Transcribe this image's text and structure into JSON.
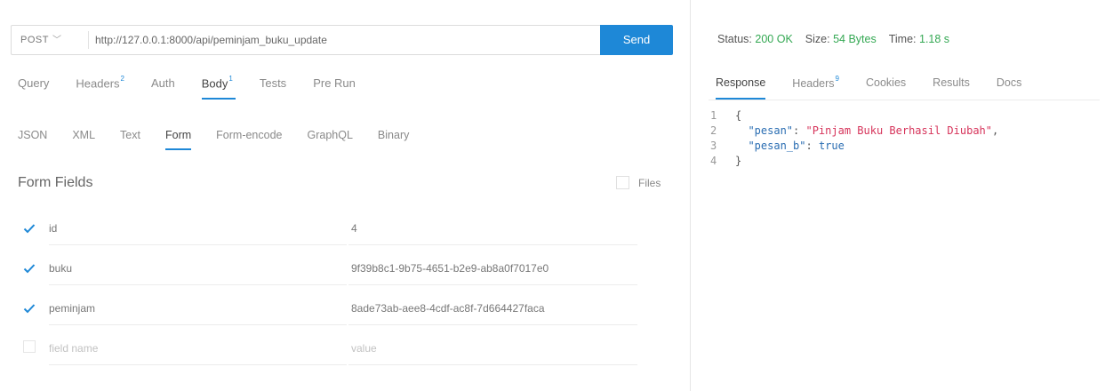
{
  "request": {
    "method": "POST",
    "url": "http://127.0.0.1:8000/api/peminjam_buku_update",
    "send_label": "Send"
  },
  "tabs": [
    {
      "label": "Query",
      "badge": ""
    },
    {
      "label": "Headers",
      "badge": "2"
    },
    {
      "label": "Auth",
      "badge": ""
    },
    {
      "label": "Body",
      "badge": "1"
    },
    {
      "label": "Tests",
      "badge": ""
    },
    {
      "label": "Pre Run",
      "badge": ""
    }
  ],
  "body_tabs": [
    "JSON",
    "XML",
    "Text",
    "Form",
    "Form-encode",
    "GraphQL",
    "Binary"
  ],
  "form": {
    "title": "Form Fields",
    "files_label": "Files",
    "rows": [
      {
        "name": "id",
        "value": "4",
        "checked": true
      },
      {
        "name": "buku",
        "value": "9f39b8c1-9b75-4651-b2e9-ab8a0f7017e0",
        "checked": true
      },
      {
        "name": "peminjam",
        "value": "8ade73ab-aee8-4cdf-ac8f-7d664427faca",
        "checked": true
      }
    ],
    "name_placeholder": "field name",
    "value_placeholder": "value"
  },
  "response": {
    "status_label": "Status:",
    "status_value": "200 OK",
    "size_label": "Size:",
    "size_value": "54 Bytes",
    "time_label": "Time:",
    "time_value": "1.18 s",
    "tabs": [
      {
        "label": "Response",
        "badge": ""
      },
      {
        "label": "Headers",
        "badge": "9"
      },
      {
        "label": "Cookies",
        "badge": ""
      },
      {
        "label": "Results",
        "badge": ""
      },
      {
        "label": "Docs",
        "badge": ""
      }
    ],
    "lines": [
      {
        "n": "1",
        "text": "{"
      },
      {
        "n": "2",
        "key": "\"pesan\"",
        "value": "\"Pinjam Buku Berhasil Diubah\"",
        "type": "str",
        "trail": ","
      },
      {
        "n": "3",
        "key": "\"pesan_b\"",
        "value": "true",
        "type": "bool",
        "trail": ""
      },
      {
        "n": "4",
        "text": "}"
      }
    ]
  },
  "colors": {
    "accent": "#1e88d7",
    "ok": "#34a853",
    "string": "#d6335a",
    "key": "#2a6db2"
  }
}
